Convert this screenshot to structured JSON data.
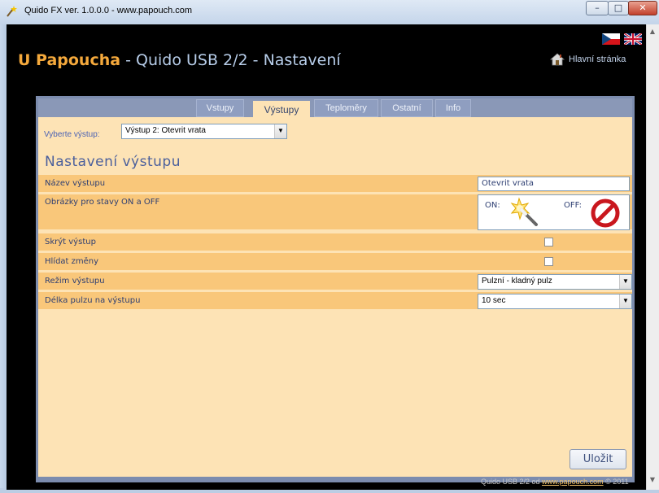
{
  "window": {
    "title": "Quido FX ver. 1.0.0.0 - www.papouch.com",
    "controls": {
      "minimize": "–",
      "maximize": "□",
      "close": "✕"
    }
  },
  "header": {
    "brand": "U Papoucha",
    "title_rest": " - Quido USB 2/2 - Nastavení",
    "home_link": "Hlavní stránka"
  },
  "tabs": [
    {
      "label": "Vstupy",
      "active": false
    },
    {
      "label": "Výstupy",
      "active": true
    },
    {
      "label": "Teploměry",
      "active": false
    },
    {
      "label": "Ostatní",
      "active": false
    },
    {
      "label": "Info",
      "active": false
    }
  ],
  "output_select": {
    "label": "Vyberte výstup:",
    "value": "Výstup 2: Otevrit vrata"
  },
  "section_heading": "Nastavení výstupu",
  "rows": {
    "name": {
      "label": "Název výstupu",
      "value": "Otevrit vrata"
    },
    "images": {
      "label": "Obrázky pro stavy ON a OFF",
      "on_label": "ON:",
      "off_label": "OFF:",
      "on_icon": "magic-wand-sparkle-icon",
      "off_icon": "no-entry-icon"
    },
    "hide": {
      "label": "Skrýt výstup",
      "checked": false
    },
    "watch": {
      "label": "Hlídat změny",
      "checked": false
    },
    "mode": {
      "label": "Režim výstupu",
      "value": "Pulzní - kladný pulz"
    },
    "pulse": {
      "label": "Délka pulzu na výstupu",
      "value": "10 sec"
    }
  },
  "save_label": "Uložit",
  "footer": {
    "prefix": "Quido USB 2/2 od ",
    "link": "www.papouch.com",
    "suffix": " © 2011"
  },
  "colors": {
    "brand": "#f5a93c",
    "panel": "#fde3b5",
    "row": "#f9c77a",
    "tabbar": "#8a98b7"
  }
}
